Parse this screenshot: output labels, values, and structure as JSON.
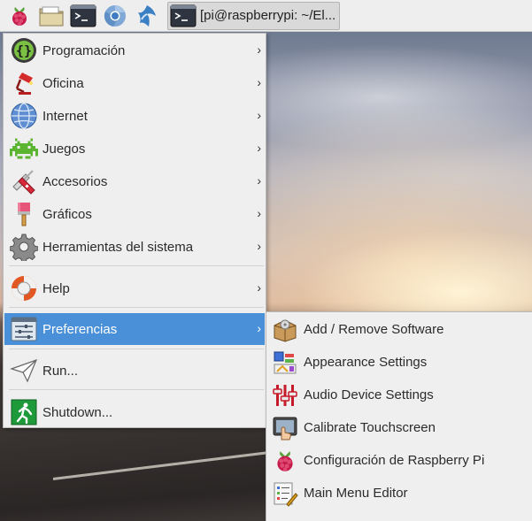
{
  "panel": {
    "launchers": [
      {
        "icon": "raspberry-menu-icon"
      },
      {
        "icon": "file-manager-icon"
      },
      {
        "icon": "terminal-icon"
      },
      {
        "icon": "chromium-browser-icon"
      },
      {
        "icon": "wolfram-mathematica-icon"
      }
    ],
    "task": {
      "icon": "terminal-icon",
      "label": "[pi@raspberrypi: ~/El..."
    }
  },
  "menu": {
    "items": [
      {
        "label": "Programación",
        "icon": "programming-icon",
        "submenu": true
      },
      {
        "label": "Oficina",
        "icon": "office-lamp-icon",
        "submenu": true
      },
      {
        "label": "Internet",
        "icon": "globe-icon",
        "submenu": true
      },
      {
        "label": "Juegos",
        "icon": "space-invader-icon",
        "submenu": true
      },
      {
        "label": "Accesorios",
        "icon": "swiss-knife-icon",
        "submenu": true
      },
      {
        "label": "Gráficos",
        "icon": "paintbrush-icon",
        "submenu": true
      },
      {
        "label": "Herramientas del sistema",
        "icon": "gear-icon",
        "submenu": true
      },
      {
        "label": "Help",
        "icon": "lifebuoy-icon",
        "submenu": true
      },
      {
        "label": "Preferencias",
        "icon": "preferences-sliders-icon",
        "submenu": true,
        "active": true
      },
      {
        "label": "Run...",
        "icon": "paper-plane-icon",
        "submenu": false
      },
      {
        "label": "Shutdown...",
        "icon": "exit-running-man-icon",
        "submenu": false
      }
    ],
    "arrow_glyph": "›"
  },
  "submenu": {
    "items": [
      {
        "label": "Add / Remove Software",
        "icon": "package-box-icon"
      },
      {
        "label": "Appearance Settings",
        "icon": "appearance-palette-icon"
      },
      {
        "label": "Audio Device Settings",
        "icon": "audio-mixer-icon"
      },
      {
        "label": "Calibrate Touchscreen",
        "icon": "touchscreen-hand-icon"
      },
      {
        "label": "Configuración de Raspberry Pi",
        "icon": "raspberry-icon"
      },
      {
        "label": "Main Menu Editor",
        "icon": "menu-editor-icon"
      }
    ]
  },
  "colors": {
    "menu_bg": "#efefef",
    "highlight": "#4a90d9",
    "panel_bg": "#eeeeee"
  }
}
